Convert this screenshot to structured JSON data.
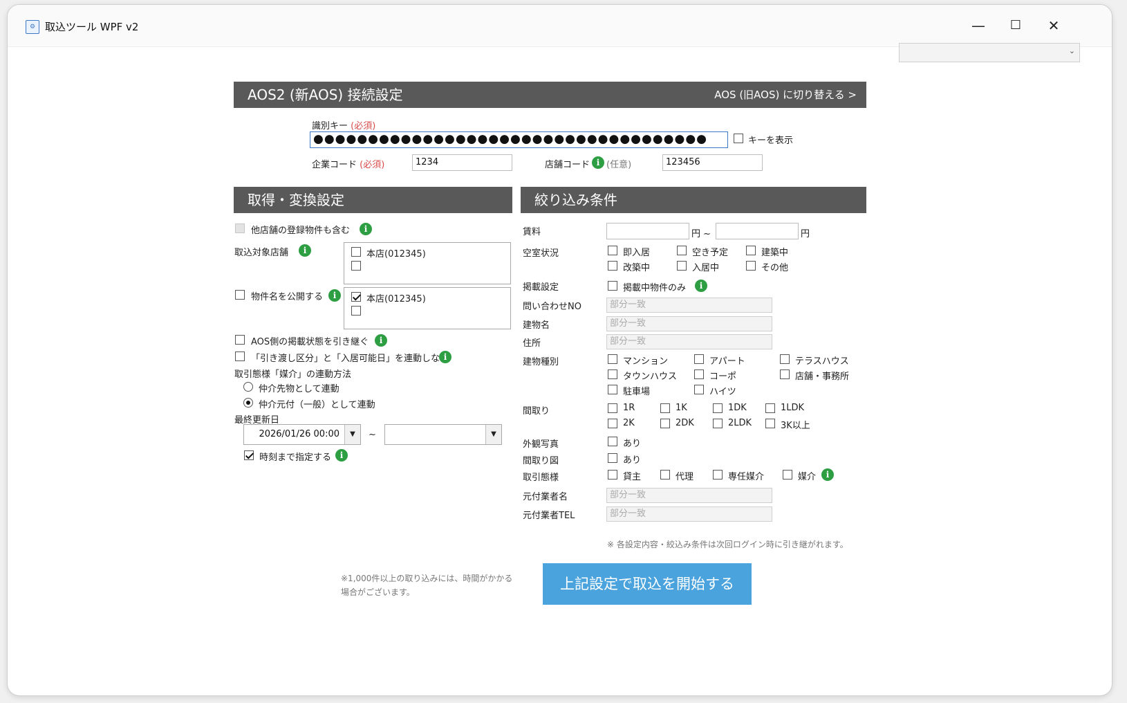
{
  "window": {
    "title": "取込ツール WPF v2",
    "icon": "app-icon",
    "minimize": "—",
    "maximize": "☐",
    "close": "✕"
  },
  "top_select": {
    "value": ""
  },
  "connection": {
    "header": "AOS2 (新AOS) 接続設定",
    "switch_link": "AOS (旧AOS) に切り替える >",
    "key_label": "識別キー",
    "required": "(必須)",
    "optional": "(任意)",
    "key_value": "●●●●●●●●●●●●●●●●●●●●●●●●●●●●●●●●●●●●",
    "show_key": "キーを表示",
    "company_code_label": "企業コード",
    "company_code_value": "1234",
    "store_code_label": "店舗コード",
    "store_code_value": "123456"
  },
  "acquire": {
    "header": "取得・変換設定",
    "include_other_stores": "他店舗の登録物件も含む",
    "target_store_label": "取込対象店舗",
    "target_stores": [
      "本店(012345)",
      ""
    ],
    "publish_name_label": "物件名を公開する",
    "publish_stores": [
      "本店(012345)",
      ""
    ],
    "inherit_aos_status": "AOS側の掲載状態を引き継ぐ",
    "no_link_delivery": "「引き渡し区分」と「入居可能日」を連動しない",
    "broker_method_label": "取引態様「媒介」の連動方法",
    "broker_options": [
      "仲介先物として連動",
      "仲介元付（一般）として連動"
    ],
    "last_updated_label": "最終更新日",
    "date_from": "2026/01/26 00:00",
    "date_to": "",
    "tilde": "~",
    "specify_time": "時刻まで指定する"
  },
  "filter": {
    "header": "絞り込み条件",
    "rent_label": "賃料",
    "rent_from": "",
    "rent_to": "",
    "yen_tilde": "円 ~",
    "yen": "円",
    "vacancy_label": "空室状況",
    "vacancy": [
      "即入居",
      "空き予定",
      "建築中",
      "改築中",
      "入居中",
      "その他"
    ],
    "listing_label": "掲載設定",
    "listing_only": "掲載中物件のみ",
    "inquiry_label": "問い合わせNO",
    "building_label": "建物名",
    "address_label": "住所",
    "partial_match": "部分一致",
    "building_type_label": "建物種別",
    "building_types": [
      "マンション",
      "アパート",
      "テラスハウス",
      "タウンハウス",
      "コーポ",
      "店舗・事務所",
      "駐車場",
      "ハイツ"
    ],
    "layout_label": "間取り",
    "layouts": [
      "1R",
      "1K",
      "1DK",
      "1LDK",
      "2K",
      "2DK",
      "2LDK",
      "3K以上"
    ],
    "exterior_label": "外観写真",
    "floorplan_label": "間取り図",
    "yes": "あり",
    "trade_label": "取引態様",
    "trades": [
      "貸主",
      "代理",
      "専任媒介",
      "媒介"
    ],
    "agent_name_label": "元付業者名",
    "agent_tel_label": "元付業者TEL",
    "note": "※ 各設定内容・絞込み条件は次回ログイン時に引き継がれます。"
  },
  "footer": {
    "warning_line1": "※1,000件以上の取り込みには、時間がかかる",
    "warning_line2": "場合がございます。",
    "start_button": "上記設定で取込を開始する"
  },
  "colors": {
    "header_bg": "#595959",
    "accent": "#4aa3dd",
    "info": "#2e9e43",
    "required": "#d84c4c"
  }
}
